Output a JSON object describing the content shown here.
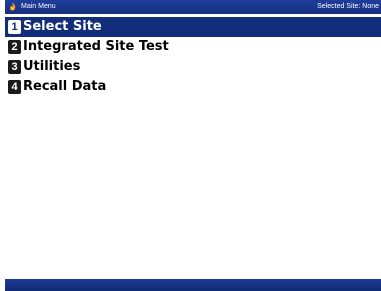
{
  "titlebar": {
    "icon": "flame-icon",
    "title": "Main Menu",
    "status": "Selected Site: None"
  },
  "menu": {
    "items": [
      {
        "number": "1",
        "label": "Select Site",
        "selected": true
      },
      {
        "number": "2",
        "label": "Integrated Site Test",
        "selected": false
      },
      {
        "number": "3",
        "label": "Utilities",
        "selected": false
      },
      {
        "number": "4",
        "label": "Recall Data",
        "selected": false
      }
    ]
  },
  "colors": {
    "titlebar": "#1f3d9c",
    "selection": "#122d7a",
    "badge": "#1b1b1b",
    "background": "#ffffff"
  }
}
